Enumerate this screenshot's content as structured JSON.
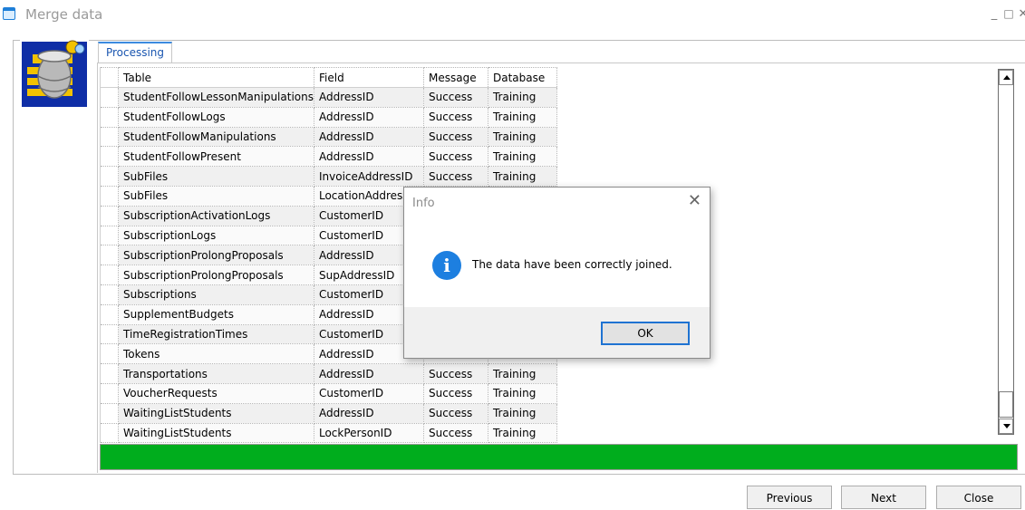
{
  "window": {
    "title": "Merge data",
    "minimize_glyph": "_",
    "maximize_glyph": "□",
    "close_glyph": "✕"
  },
  "icons": {
    "window_icon": "window-icon",
    "logo": "database-merge-icon",
    "info": "info-icon"
  },
  "tab": {
    "label": "Processing"
  },
  "table": {
    "columns": [
      "Table",
      "Field",
      "Message",
      "Database"
    ],
    "rows": [
      [
        "StudentFollowLessonManipulations",
        "AddressID",
        "Success",
        "Training"
      ],
      [
        "StudentFollowLogs",
        "AddressID",
        "Success",
        "Training"
      ],
      [
        "StudentFollowManipulations",
        "AddressID",
        "Success",
        "Training"
      ],
      [
        "StudentFollowPresent",
        "AddressID",
        "Success",
        "Training"
      ],
      [
        "SubFiles",
        "InvoiceAddressID",
        "Success",
        "Training"
      ],
      [
        "SubFiles",
        "LocationAddressID",
        "",
        ""
      ],
      [
        "SubscriptionActivationLogs",
        "CustomerID",
        "",
        ""
      ],
      [
        "SubscriptionLogs",
        "CustomerID",
        "",
        ""
      ],
      [
        "SubscriptionProlongProposals",
        "AddressID",
        "",
        ""
      ],
      [
        "SubscriptionProlongProposals",
        "SupAddressID",
        "",
        ""
      ],
      [
        "Subscriptions",
        "CustomerID",
        "",
        ""
      ],
      [
        "SupplementBudgets",
        "AddressID",
        "",
        ""
      ],
      [
        "TimeRegistrationTimes",
        "CustomerID",
        "",
        ""
      ],
      [
        "Tokens",
        "AddressID",
        "",
        ""
      ],
      [
        "Transportations",
        "AddressID",
        "Success",
        "Training"
      ],
      [
        "VoucherRequests",
        "CustomerID",
        "Success",
        "Training"
      ],
      [
        "WaitingListStudents",
        "AddressID",
        "Success",
        "Training"
      ],
      [
        "WaitingListStudents",
        "LockPersonID",
        "Success",
        "Training"
      ]
    ]
  },
  "progress": {
    "percent": 100,
    "color": "#00ad1d"
  },
  "buttons": {
    "previous": "Previous",
    "next": "Next",
    "close": "Close"
  },
  "dialog": {
    "title": "Info",
    "close_glyph": "✕",
    "info_glyph": "i",
    "message": "The data have been correctly joined.",
    "ok": "OK"
  },
  "colors": {
    "accent": "#1d7fe0",
    "progress": "#00ad1d"
  }
}
